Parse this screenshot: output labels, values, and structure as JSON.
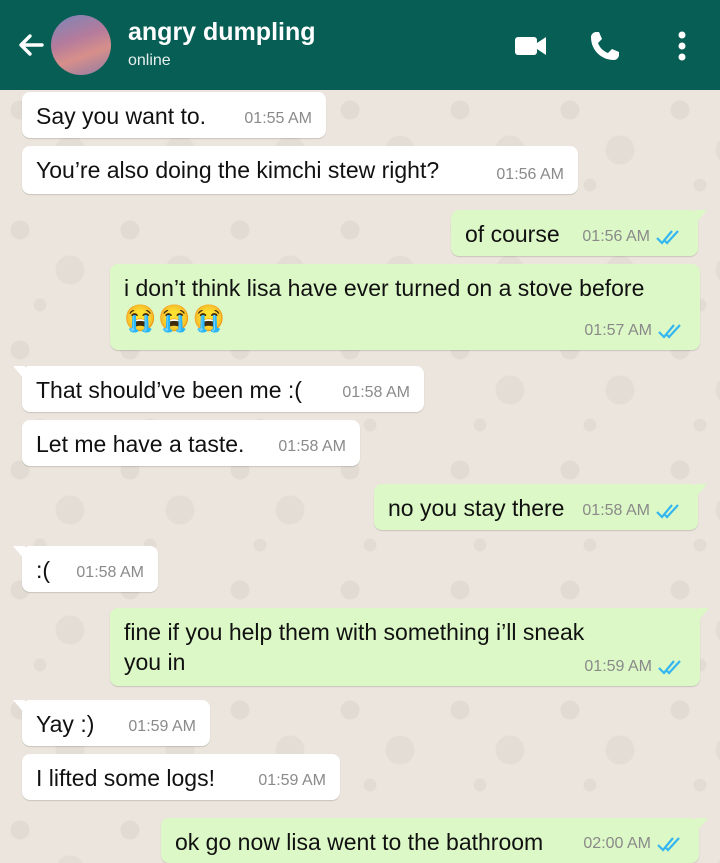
{
  "header": {
    "contact_name": "angry dumpling",
    "status": "online",
    "colors": {
      "bar": "#075e54",
      "text": "#ffffff"
    },
    "icons": [
      "back-arrow-icon",
      "video-call-icon",
      "voice-call-icon",
      "more-options-icon"
    ]
  },
  "messages": [
    {
      "dir": "in",
      "text": "Say you want to.",
      "time": "01:55 AM"
    },
    {
      "dir": "in",
      "text": "You’re also doing the kimchi stew right?",
      "time": "01:56 AM"
    },
    {
      "dir": "out",
      "text": "of course",
      "time": "01:56 AM",
      "read": true
    },
    {
      "dir": "out",
      "text": "i don’t think lisa have ever turned on a stove before",
      "emoji": "😭😭😭",
      "time": "01:57 AM",
      "read": true
    },
    {
      "dir": "in",
      "text": "That should’ve been me :(",
      "time": "01:58 AM"
    },
    {
      "dir": "in",
      "text": "Let me have a taste.",
      "time": "01:58 AM"
    },
    {
      "dir": "out",
      "text": "no you stay there",
      "time": "01:58 AM",
      "read": true
    },
    {
      "dir": "in",
      "text": ":(",
      "time": "01:58 AM"
    },
    {
      "dir": "out",
      "text_line1": "fine if you help them with something i’ll sneak",
      "text_line2": "you in",
      "time": "01:59 AM",
      "read": true
    },
    {
      "dir": "in",
      "text": "Yay :)",
      "time": "01:59 AM"
    },
    {
      "dir": "in",
      "text": "I lifted some logs!",
      "time": "01:59 AM"
    },
    {
      "dir": "out",
      "text": "ok go now lisa went to the bathroom",
      "time": "02:00 AM",
      "read": true
    }
  ],
  "colors": {
    "incoming": "#ffffff",
    "outgoing": "#dcf8c6",
    "read_tick": "#34b7f1",
    "wallpaper": "#ece5dd"
  }
}
